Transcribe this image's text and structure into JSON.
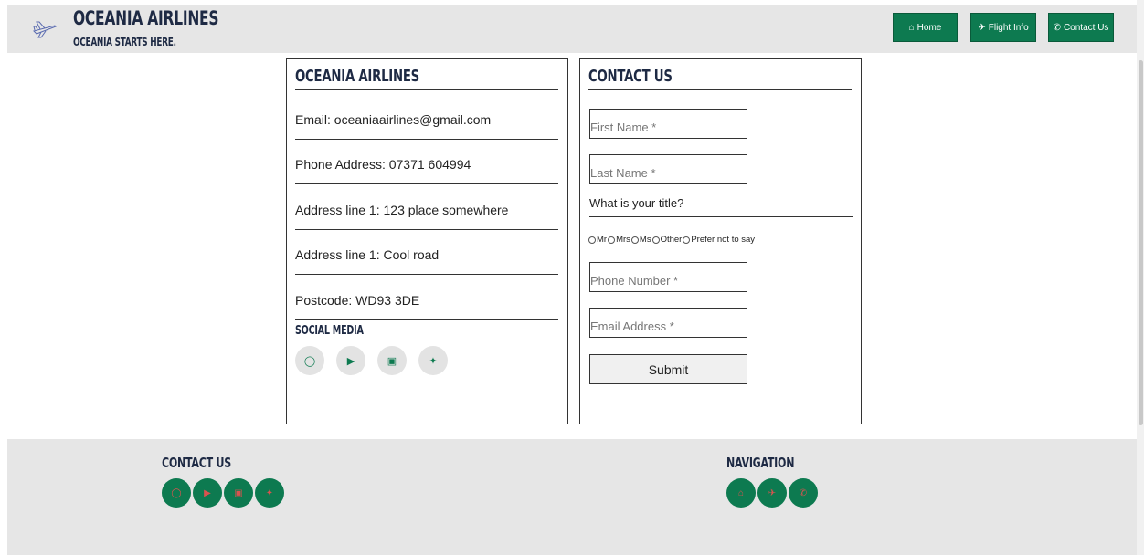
{
  "header": {
    "brand_title": "OCEANIA AIRLINES",
    "brand_tagline": "OCEANIA STARTS HERE.",
    "nav": [
      {
        "label": "Home",
        "icon": "home-icon"
      },
      {
        "label": "Flight Info",
        "icon": "plane-icon"
      },
      {
        "label": "Contact Us",
        "icon": "phone-icon"
      }
    ]
  },
  "info_panel": {
    "title": "OCEANIA AIRLINES",
    "lines": [
      "Email: oceaniaairlines@gmail.com",
      "Phone Address: 07371 604994",
      "Address line 1: 123 place somewhere",
      "Address line 1: Cool road",
      "Postcode: WD93 3DE"
    ],
    "social_title": "SOCIAL MEDIA",
    "social_icons": [
      "instagram-icon",
      "youtube-icon",
      "facebook-icon",
      "twitter-icon"
    ]
  },
  "contact_panel": {
    "title": "CONTACT US",
    "first_name_placeholder": "First Name *",
    "last_name_placeholder": "Last Name *",
    "title_question": "What is your title?",
    "title_options": [
      "Mr",
      "Mrs",
      "Ms",
      "Other",
      "Prefer not to say"
    ],
    "phone_placeholder": "Phone Number *",
    "email_placeholder": "Email Address *",
    "submit_label": "Submit"
  },
  "footer": {
    "contact_title": "CONTACT US",
    "contact_icons": [
      "instagram-icon",
      "youtube-icon",
      "facebook-icon",
      "twitter-icon"
    ],
    "navigation_title": "NAVIGATION",
    "navigation_icons": [
      "home-icon",
      "plane-icon",
      "phone-icon"
    ]
  },
  "colors": {
    "accent_green": "#0d7a50",
    "header_bg": "#e6e6e6",
    "brand_navy": "#1e2a44",
    "footer_icon": "#d9534f"
  }
}
